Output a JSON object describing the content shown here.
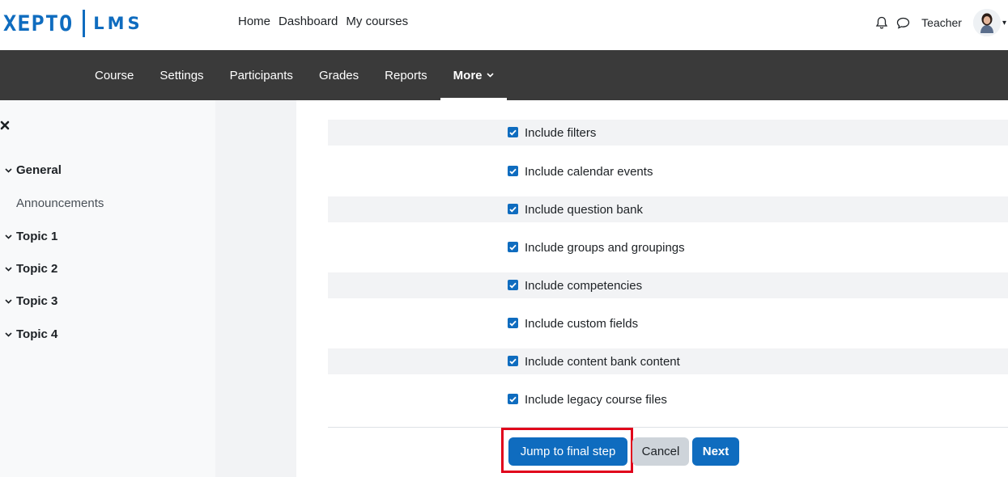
{
  "brand": {
    "logo_left": "XEPTO",
    "logo_right": "LMS",
    "accent": "#0f6cbf"
  },
  "primary_nav": [
    "Home",
    "Dashboard",
    "My courses"
  ],
  "user": {
    "name": "Teacher",
    "notification_icon": "bell-icon",
    "messages_icon": "chat-bubble-icon"
  },
  "secondary_nav": {
    "tabs": [
      "Course",
      "Settings",
      "Participants",
      "Grades",
      "Reports"
    ],
    "more": "More",
    "bg": "#3a3a3a"
  },
  "course_index": {
    "close_icon": "close-icon",
    "items": [
      {
        "label": "General",
        "type": "section"
      },
      {
        "label": "Announcements",
        "type": "activity"
      },
      {
        "label": "Topic 1",
        "type": "section"
      },
      {
        "label": "Topic 2",
        "type": "section"
      },
      {
        "label": "Topic 3",
        "type": "section"
      },
      {
        "label": "Topic 4",
        "type": "section"
      }
    ]
  },
  "settings": [
    {
      "label": "Include filters",
      "checked": true
    },
    {
      "label": "Include calendar events",
      "checked": true
    },
    {
      "label": "Include question bank",
      "checked": true
    },
    {
      "label": "Include groups and groupings",
      "checked": true
    },
    {
      "label": "Include competencies",
      "checked": true
    },
    {
      "label": "Include custom fields",
      "checked": true
    },
    {
      "label": "Include content bank content",
      "checked": true
    },
    {
      "label": "Include legacy course files",
      "checked": true
    }
  ],
  "actions": {
    "jump": "Jump to final step",
    "cancel": "Cancel",
    "next": "Next",
    "highlight_color": "#e0001b"
  }
}
